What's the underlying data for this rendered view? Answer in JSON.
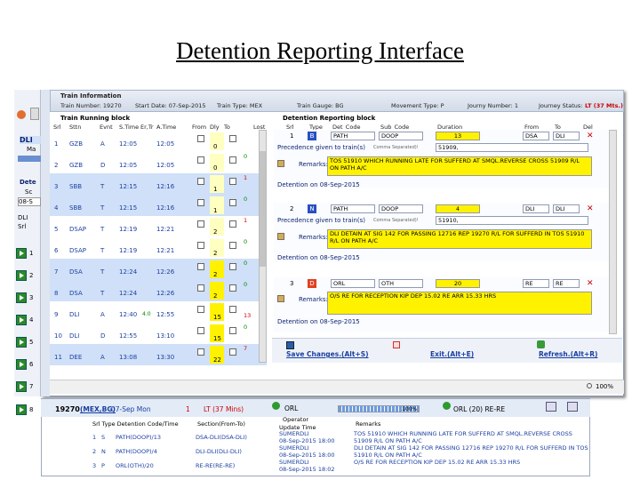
{
  "slide_title": "Detention Reporting Interface",
  "info": {
    "section_title": "Train Information",
    "train_number": "Train Number: 19270",
    "start_date": "Start Date: 07-Sep-2015",
    "train_type": "Train Type: MEX",
    "gauge": "Train Gauge: BG",
    "movement": "Movement Type: P",
    "journey_number": "Journy Number: 1",
    "journey_status_label": "Journey Status:",
    "journey_status_value": "LT (37 Mts.)"
  },
  "running": {
    "title": "Train Running block",
    "headers": [
      "Srl",
      "Sttn",
      "Evnt",
      "S.Time",
      "Er,Tr",
      "A.Time",
      "From",
      "Dly",
      "To",
      "Lost"
    ],
    "rows": [
      {
        "srl": "1",
        "sttn": "GZB",
        "evnt": "A",
        "stime": "12:05",
        "er": "",
        "atime": "12:05",
        "dly": "0",
        "lost": "",
        "extra": ""
      },
      {
        "srl": "2",
        "sttn": "GZB",
        "evnt": "D",
        "stime": "12:05",
        "er": "",
        "atime": "12:05",
        "dly": "0",
        "lost": "0",
        "extra": ""
      },
      {
        "srl": "3",
        "sttn": "SBB",
        "evnt": "T",
        "stime": "12:15",
        "er": "",
        "atime": "12:16",
        "dly": "1",
        "lost": "1",
        "extra": ""
      },
      {
        "srl": "4",
        "sttn": "SBB",
        "evnt": "T",
        "stime": "12:15",
        "er": "",
        "atime": "12:16",
        "dly": "1",
        "lost": "0",
        "extra": ""
      },
      {
        "srl": "5",
        "sttn": "DSAP",
        "evnt": "T",
        "stime": "12:19",
        "er": "",
        "atime": "12:21",
        "dly": "2",
        "lost": "1",
        "extra": ""
      },
      {
        "srl": "6",
        "sttn": "DSAP",
        "evnt": "T",
        "stime": "12:19",
        "er": "",
        "atime": "12:21",
        "dly": "2",
        "lost": "0",
        "extra": ""
      },
      {
        "srl": "7",
        "sttn": "DSA",
        "evnt": "T",
        "stime": "12:24",
        "er": "",
        "atime": "12:26",
        "dly": "2",
        "lost": "0",
        "extra": ""
      },
      {
        "srl": "8",
        "sttn": "DSA",
        "evnt": "T",
        "stime": "12:24",
        "er": "",
        "atime": "12:26",
        "dly": "2",
        "lost": "0",
        "extra": ""
      },
      {
        "srl": "9",
        "sttn": "DLI",
        "evnt": "A",
        "stime": "12:40",
        "er": "4.0",
        "atime": "12:55",
        "dly": "15",
        "lost": "13",
        "extra": ""
      },
      {
        "srl": "10",
        "sttn": "DLI",
        "evnt": "D",
        "stime": "12:55",
        "er": "",
        "atime": "13:10",
        "dly": "15",
        "lost": "0",
        "extra": ""
      },
      {
        "srl": "11",
        "sttn": "DEE",
        "evnt": "A",
        "stime": "13:08",
        "er": "",
        "atime": "13:30",
        "dly": "22",
        "lost": "7",
        "extra": ""
      }
    ]
  },
  "detention": {
    "title": "Detention Reporting block",
    "headers": [
      "Srl",
      "Type",
      "Det_Code",
      "Sub_Code",
      "Duration",
      "From",
      "To",
      "Del"
    ],
    "entries": [
      {
        "srl": "1",
        "type": "B",
        "det_code": "PATH",
        "sub_code": "DOOP",
        "duration": "13",
        "from": "DSA",
        "to": "DLI",
        "del": "✕",
        "prec_label": "Precedence given to train(s)",
        "prec_note": "Comma Separated)!",
        "prec_value": "51909,",
        "remarks_label": "Remarks:",
        "remarks": "TOS 51910 WHICH RUNNING LATE FOR SUFFERD AT SMQL.REVERSE CROSS 51909 R/L ON PATH A/C",
        "det_on": "Detention on 08-Sep-2015"
      },
      {
        "srl": "2",
        "type": "N",
        "det_code": "PATH",
        "sub_code": "DOOP",
        "duration": "4",
        "from": "DLI",
        "to": "DLI",
        "del": "✕",
        "prec_label": "Precedence given to train(s)",
        "prec_note": "Comma Separated)!",
        "prec_value": "51910,",
        "remarks_label": "Remarks:",
        "remarks": "DLI DETAIN AT SIG 142 FOR PASSING 12716 REP 19270 R/L FOR SUFFERD IN TOS 51910 R/L ON PATH A/C",
        "det_on": "Detention on 08-Sep-2015"
      },
      {
        "srl": "3",
        "type": "D",
        "det_code": "ORL",
        "sub_code": "OTH",
        "duration": "20",
        "from": "RE",
        "to": "RE",
        "del": "✕",
        "prec_label": "",
        "prec_note": "",
        "prec_value": "",
        "remarks_label": "Remarks:",
        "remarks": "O/S RE FOR RECEPTION KIP DEP 15.02 RE ARR 15.33 HRS",
        "det_on": "Detention on 08-Sep-2015"
      }
    ],
    "save": "Save Changes.(Alt+S)",
    "exit": "Exit.(Alt+E)",
    "refresh": "Refresh.(Alt+R)"
  },
  "zoom": "100%",
  "side": {
    "dli": "DLI",
    "ma": "Ma",
    "dete": "Dete",
    "sc": "Sc",
    "val08": "08-S",
    "dli2": "DLI",
    "srl": "Srl",
    "nums": [
      "1",
      "2",
      "3",
      "4",
      "5",
      "6",
      "7",
      "8"
    ]
  },
  "bottom": {
    "train": "19270",
    "link": "(MEX,BG)",
    "date": "07-Sep Mon",
    "one": "1",
    "lt": "LT (37 Mins)",
    "orl": "ORL",
    "progress_label": "100%",
    "progress": 1.0,
    "orl2": "ORL (20) RE-RE",
    "headers": {
      "a": "Srl Type Detention Code/Time",
      "b": "Section(From-To)",
      "c": "Operator",
      "d": "Update Time",
      "e": "Remarks"
    },
    "rows": [
      {
        "srl": "1",
        "type": "S",
        "code": "PATH(DOOP)/13",
        "section": "DSA-DLI(DSA-DLI)",
        "op": "SUMERDLI",
        "time": "08-Sep-2015 18:00",
        "remarks": "TOS 51910 WHICH RUNNING LATE FOR SUFFERD AT SMQL.REVERSE CROSS 51909 R/L ON PATH A/C"
      },
      {
        "srl": "2",
        "type": "N",
        "code": "PATH(DOOP)/4",
        "section": "DLI-DLI(DLI-DLI)",
        "op": "SUMERDLI",
        "time": "08-Sep-2015 18:00",
        "remarks": "DLI DETAIN AT SIG 142 FOR PASSING 12716 REP 19270 R/L FOR SUFFERD IN TOS 51910 R/L ON PATH A/C"
      },
      {
        "srl": "3",
        "type": "P",
        "code": "ORL(OTH)/20",
        "section": "RE-RE(RE-RE)",
        "op": "SUMERDLI",
        "time": "08-Sep-2015 18:02",
        "remarks": "O/S RE FOR RECEPTION KIP DEP 15.02 RE ARR 15.33 HRS"
      }
    ]
  }
}
